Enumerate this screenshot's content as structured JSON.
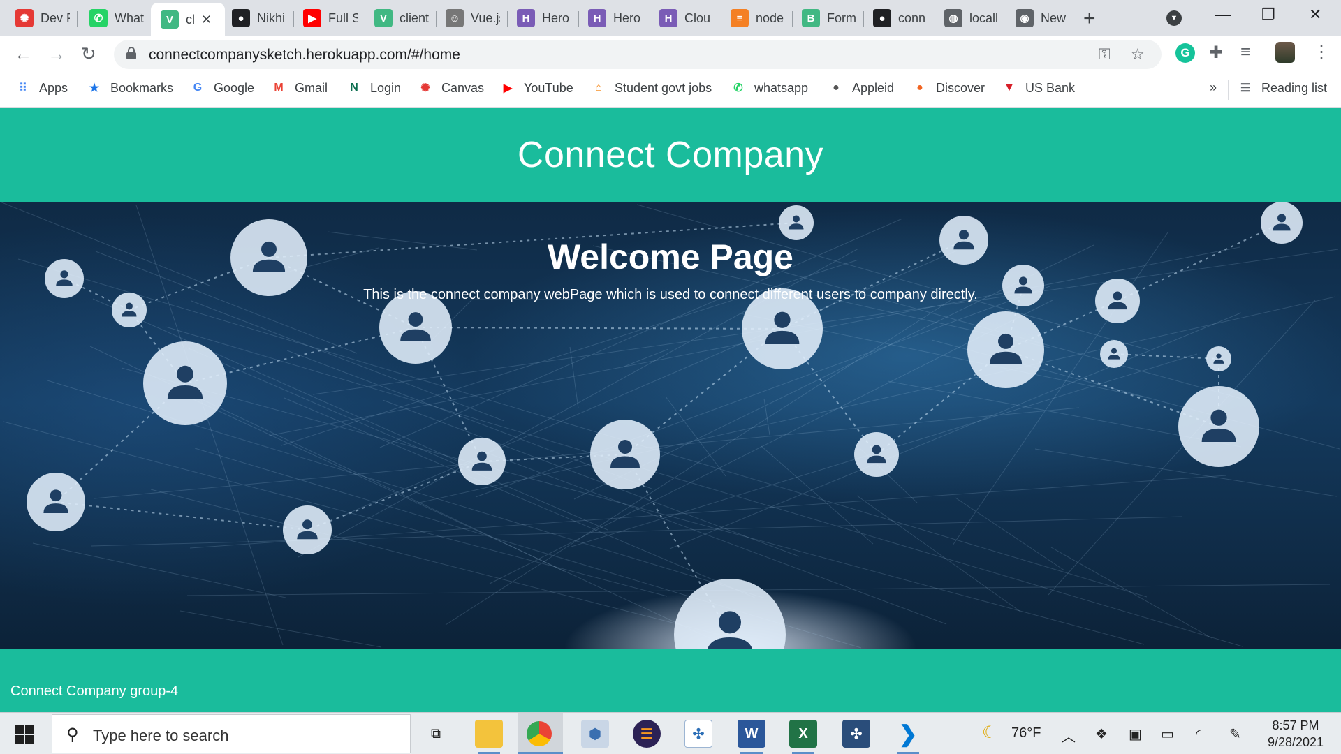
{
  "browser": {
    "tabs": [
      {
        "title": "Dev F",
        "icon": "canvas-icon",
        "color": "#e53935"
      },
      {
        "title": "What",
        "icon": "whatsapp-icon",
        "color": "#25d366"
      },
      {
        "title": "cl",
        "icon": "vue-icon",
        "color": "#41b883",
        "active": true
      },
      {
        "title": "Nikhi",
        "icon": "github-icon",
        "color": "#202124"
      },
      {
        "title": "Full S",
        "icon": "youtube-icon",
        "color": "#ff0000"
      },
      {
        "title": "client",
        "icon": "vue-icon",
        "color": "#41b883"
      },
      {
        "title": "Vue.js",
        "icon": "person-icon",
        "color": "#777777"
      },
      {
        "title": "Hero",
        "icon": "heroku-icon",
        "color": "#7a5cb6"
      },
      {
        "title": "Hero",
        "icon": "heroku-icon",
        "color": "#7a5cb6"
      },
      {
        "title": "Clou",
        "icon": "heroku-icon",
        "color": "#7a5cb6"
      },
      {
        "title": "node",
        "icon": "stackoverflow-icon",
        "color": "#f48024"
      },
      {
        "title": "Form",
        "icon": "bootstrap-vue-icon",
        "color": "#41b883"
      },
      {
        "title": "conn",
        "icon": "github-icon",
        "color": "#202124"
      },
      {
        "title": "locall",
        "icon": "globe-icon",
        "color": "#5f6368"
      },
      {
        "title": "New",
        "icon": "chrome-icon",
        "color": "#5f6368"
      }
    ],
    "close_tab": "✕",
    "new_tab": "+",
    "url": "connectcompanysketch.herokuapp.com/#/home",
    "bookmarks": [
      {
        "label": "Apps",
        "icon": "apps-grid-icon",
        "color": "#4285f4"
      },
      {
        "label": "Bookmarks",
        "icon": "star-icon",
        "color": "#1a73e8"
      },
      {
        "label": "Google",
        "icon": "google-icon",
        "color": "#4285f4"
      },
      {
        "label": "Gmail",
        "icon": "gmail-icon",
        "color": "#ea4335"
      },
      {
        "label": "Login",
        "icon": "n-logo-icon",
        "color": "#0b6e4f"
      },
      {
        "label": "Canvas",
        "icon": "canvas-icon",
        "color": "#e53935"
      },
      {
        "label": "YouTube",
        "icon": "youtube-icon",
        "color": "#ff0000"
      },
      {
        "label": "Student govt jobs",
        "icon": "govt-jobs-icon",
        "color": "#f57c00"
      },
      {
        "label": "whatsapp",
        "icon": "whatsapp-icon",
        "color": "#25d366"
      },
      {
        "label": "Appleid",
        "icon": "apple-icon",
        "color": "#555555"
      },
      {
        "label": "Discover",
        "icon": "discover-icon",
        "color": "#f26522"
      },
      {
        "label": "US Bank",
        "icon": "usbank-icon",
        "color": "#d71e28"
      }
    ],
    "more_bookmarks": "»",
    "reading_list": "Reading list"
  },
  "page": {
    "header_title": "Connect Company",
    "hero_title": "Welcome Page",
    "hero_text": "This is the connect company webPage which is used to connect different users to company directly.",
    "footer_text": "Connect Company group-4",
    "accent_color": "#1abc9c"
  },
  "taskbar": {
    "search_placeholder": "Type here to search",
    "weather": "76°F",
    "time": "8:57 PM",
    "date": "9/28/2021"
  }
}
